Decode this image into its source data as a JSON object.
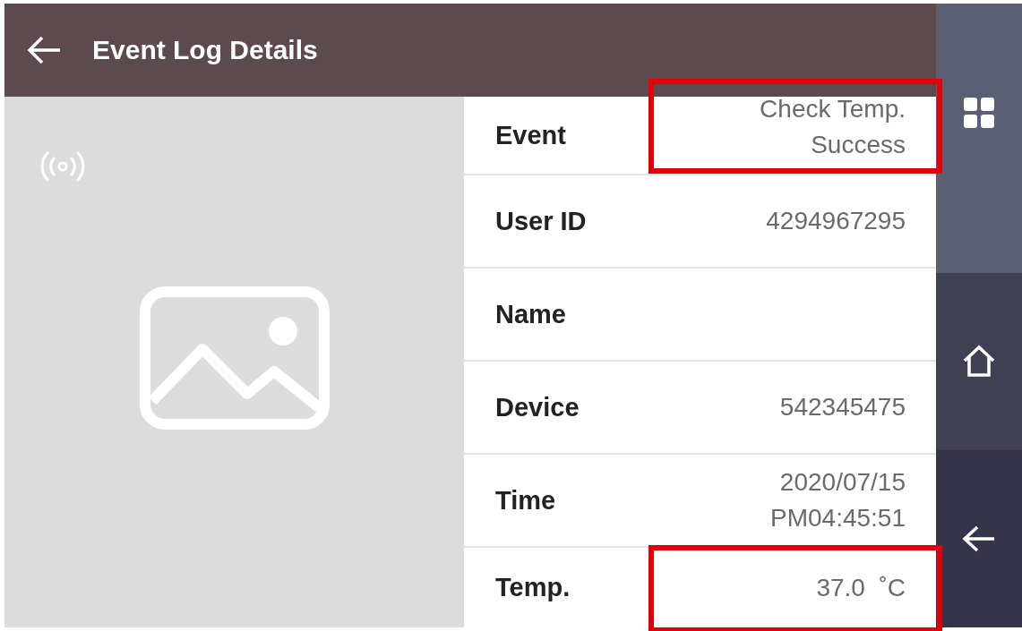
{
  "header": {
    "title": "Event Log Details"
  },
  "rows": [
    {
      "label": "Event",
      "value_lines": [
        "Check Temp.",
        "Success"
      ],
      "highlighted": true
    },
    {
      "label": "User ID",
      "value_lines": [
        "4294967295"
      ],
      "highlighted": false
    },
    {
      "label": "Name",
      "highlighted": false
    },
    {
      "label": "Device",
      "value_lines": [
        "542345475"
      ],
      "highlighted": false
    },
    {
      "label": "Time",
      "value_lines": [
        "2020/07/15",
        "PM04:45:51"
      ],
      "highlighted": false
    },
    {
      "label": "Temp.",
      "value_lines": [
        "37.0  ˚C"
      ],
      "highlighted": true
    }
  ],
  "sidebar": {
    "items": [
      {
        "kind": "grid"
      },
      {
        "kind": "home"
      },
      {
        "kind": "back"
      }
    ]
  }
}
